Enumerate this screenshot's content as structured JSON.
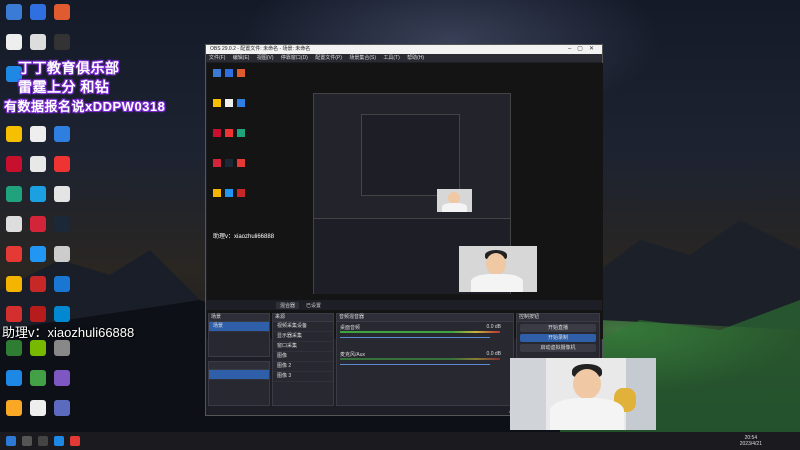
{
  "overlay": {
    "line1": "丁丁教育俱乐部",
    "line2": "雷霆上分 和钻",
    "line3": "有数据报名说xDDPW0318",
    "assistant": "助理v：xiaozhuli66888"
  },
  "obs": {
    "title": "OBS 29.0.2 - 配置文件: 未命名 - 场景: 未命名",
    "menu": [
      "文件(F)",
      "编辑(E)",
      "视图(V)",
      "停靠窗口(D)",
      "配置文件(P)",
      "场景集合(S)",
      "工具(T)",
      "帮助(H)"
    ],
    "mini_assistant": "助理v：xiaozhuli66888",
    "tabs": [
      "混合器",
      "已设置"
    ],
    "scenes_label": "场景",
    "scenes": [
      "场景"
    ],
    "sources_label": "来源",
    "sources": [
      "视频采集设备",
      "显示器采集",
      "窗口采集",
      "图像",
      "图像 2",
      "图像 3"
    ],
    "audio_label": "音频混音器",
    "audio_tracks": [
      {
        "name": "桌面音频",
        "db": "0.0 dB"
      },
      {
        "name": "麦克风/Aux",
        "db": "0.0 dB"
      }
    ],
    "controls_label": "控制按钮",
    "controls": [
      "开始直播",
      "开始录制",
      "启动虚拟摄像机"
    ],
    "status": "LIVE: 00:00:00  REC: 00:00:00  CPU: 3.4%, 60.00 fps"
  },
  "taskbar": {
    "time": "20:54",
    "date": "2023/4/21"
  }
}
